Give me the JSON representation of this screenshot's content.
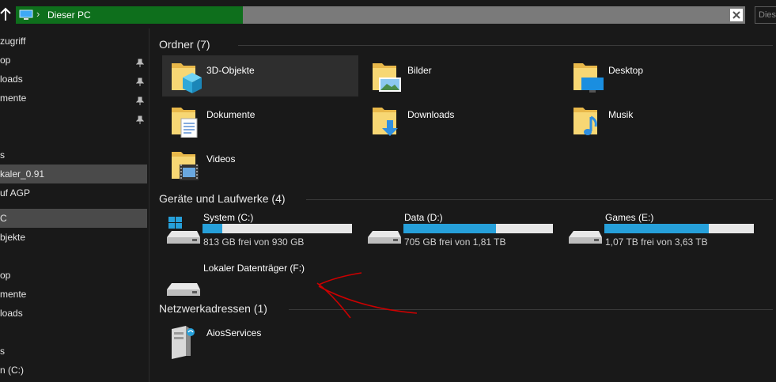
{
  "address": {
    "breadcrumb": "Dieser PC",
    "search_placeholder": "Dies"
  },
  "nav": {
    "items": [
      {
        "label": "zugriff",
        "pinned": false,
        "selected": false
      },
      {
        "label": "op",
        "pinned": true,
        "selected": false
      },
      {
        "label": "loads",
        "pinned": true,
        "selected": false
      },
      {
        "label": "mente",
        "pinned": true,
        "selected": false
      },
      {
        "label": "",
        "pinned": true,
        "selected": false
      },
      {
        "label": "s",
        "pinned": false,
        "selected": false
      },
      {
        "label": "kaler_0.91",
        "pinned": false,
        "selected": true
      },
      {
        "label": "uf AGP",
        "pinned": false,
        "selected": false
      },
      {
        "label": "C",
        "pinned": false,
        "selected": true
      },
      {
        "label": "bjekte",
        "pinned": false,
        "selected": false
      },
      {
        "label": "",
        "pinned": false,
        "selected": false
      },
      {
        "label": "op",
        "pinned": false,
        "selected": false
      },
      {
        "label": "mente",
        "pinned": false,
        "selected": false
      },
      {
        "label": "loads",
        "pinned": false,
        "selected": false
      },
      {
        "label": "",
        "pinned": false,
        "selected": false
      },
      {
        "label": "s",
        "pinned": false,
        "selected": false
      },
      {
        "label": "n (C:)",
        "pinned": false,
        "selected": false
      }
    ]
  },
  "groups": {
    "folders": {
      "header": "Ordner (7)",
      "items": [
        {
          "name": "3D-Objekte",
          "icon": "3d-objects-folder-icon"
        },
        {
          "name": "Bilder",
          "icon": "pictures-folder-icon"
        },
        {
          "name": "Desktop",
          "icon": "desktop-folder-icon"
        },
        {
          "name": "Dokumente",
          "icon": "documents-folder-icon"
        },
        {
          "name": "Downloads",
          "icon": "downloads-folder-icon"
        },
        {
          "name": "Musik",
          "icon": "music-folder-icon"
        },
        {
          "name": "Videos",
          "icon": "videos-folder-icon"
        }
      ]
    },
    "drives": {
      "header": "Geräte und Laufwerke (4)",
      "items": [
        {
          "name": "System (C:)",
          "free_text": "813 GB frei von 930 GB",
          "used_fraction": 0.13,
          "icon": "system-drive-icon"
        },
        {
          "name": "Data (D:)",
          "free_text": "705 GB frei von 1,81 TB",
          "used_fraction": 0.62,
          "icon": "hard-drive-icon"
        },
        {
          "name": "Games (E:)",
          "free_text": "1,07 TB frei von 3,63 TB",
          "used_fraction": 0.7,
          "icon": "hard-drive-icon"
        },
        {
          "name": "Lokaler Datenträger (F:)",
          "free_text": "",
          "used_fraction": null,
          "icon": "hard-drive-icon"
        }
      ]
    },
    "network": {
      "header": "Netzwerkadressen (1)",
      "items": [
        {
          "name": "AiosServices",
          "icon": "network-server-icon"
        }
      ]
    }
  },
  "colors": {
    "accent": "#26a0da",
    "address_fill": "#0e6f1c",
    "annotation": "#cc0000"
  }
}
